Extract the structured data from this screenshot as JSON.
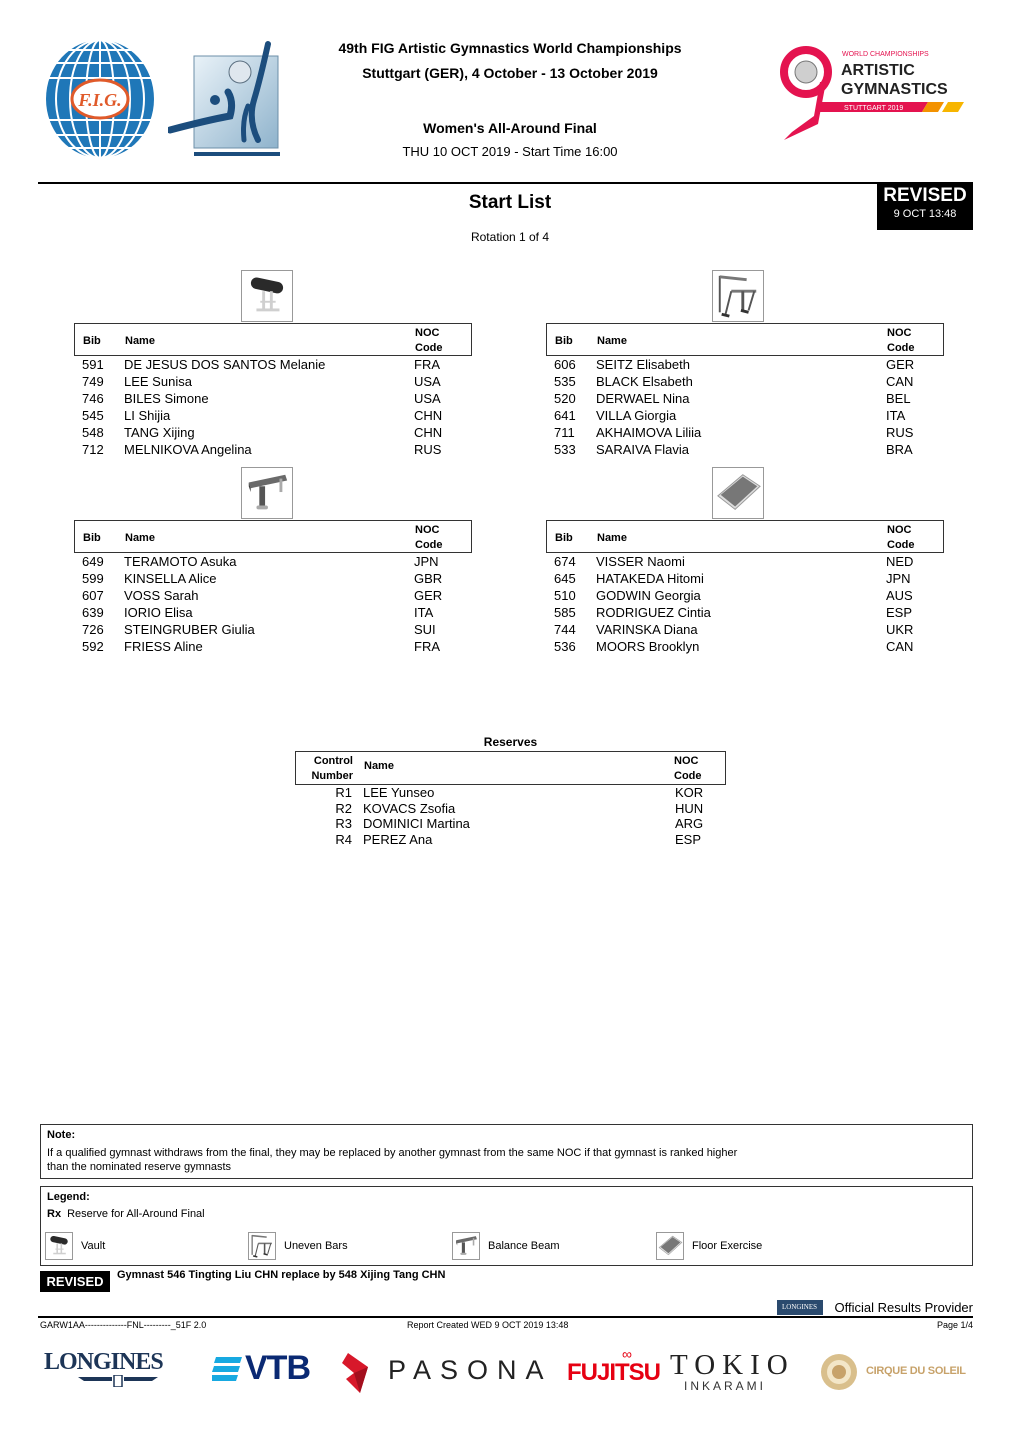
{
  "header": {
    "championship_title": "49th FIG Artistic Gymnastics World Championships",
    "location_dates": "Stuttgart (GER), 4 October - 13 October 2019",
    "event_name": "Women's All-Around Final",
    "session_info": "THU 10 OCT 2019 - Start Time 16:00",
    "logos": {
      "fig": "FIG globe logo",
      "fig_monogram": "F.I.G.",
      "event": "gymnasts emblem",
      "wc_line1": "WORLD CHAMPIONSHIPS",
      "wc_line2": "ARTISTIC",
      "wc_line3": "GYMNASTICS",
      "wc_line4": "STUTTGART 2019"
    }
  },
  "document": {
    "title": "Start List",
    "rotation": "Rotation 1 of 4",
    "revised_badge": {
      "label": "REVISED",
      "timestamp": "9 OCT 13:48"
    }
  },
  "table_headers": {
    "bib": "Bib",
    "name": "Name",
    "noc_line1": "NOC",
    "noc_line2": "Code"
  },
  "apparatus_groups": [
    {
      "apparatus": "Vault",
      "icon": "vault-icon",
      "rows": [
        {
          "bib": "591",
          "name": "DE JESUS DOS SANTOS Melanie",
          "noc": "FRA"
        },
        {
          "bib": "749",
          "name": "LEE Sunisa",
          "noc": "USA"
        },
        {
          "bib": "746",
          "name": "BILES Simone",
          "noc": "USA"
        },
        {
          "bib": "545",
          "name": "LI Shijia",
          "noc": "CHN"
        },
        {
          "bib": "548",
          "name": "TANG Xijing",
          "noc": "CHN"
        },
        {
          "bib": "712",
          "name": "MELNIKOVA Angelina",
          "noc": "RUS"
        }
      ]
    },
    {
      "apparatus": "Uneven Bars",
      "icon": "uneven-bars-icon",
      "rows": [
        {
          "bib": "606",
          "name": "SEITZ Elisabeth",
          "noc": "GER"
        },
        {
          "bib": "535",
          "name": "BLACK Elsabeth",
          "noc": "CAN"
        },
        {
          "bib": "520",
          "name": "DERWAEL Nina",
          "noc": "BEL"
        },
        {
          "bib": "641",
          "name": "VILLA Giorgia",
          "noc": "ITA"
        },
        {
          "bib": "711",
          "name": "AKHAIMOVA Liliia",
          "noc": "RUS"
        },
        {
          "bib": "533",
          "name": "SARAIVA Flavia",
          "noc": "BRA"
        }
      ]
    },
    {
      "apparatus": "Balance Beam",
      "icon": "balance-beam-icon",
      "rows": [
        {
          "bib": "649",
          "name": "TERAMOTO Asuka",
          "noc": "JPN"
        },
        {
          "bib": "599",
          "name": "KINSELLA Alice",
          "noc": "GBR"
        },
        {
          "bib": "607",
          "name": "VOSS Sarah",
          "noc": "GER"
        },
        {
          "bib": "639",
          "name": "IORIO Elisa",
          "noc": "ITA"
        },
        {
          "bib": "726",
          "name": "STEINGRUBER Giulia",
          "noc": "SUI"
        },
        {
          "bib": "592",
          "name": "FRIESS Aline",
          "noc": "FRA"
        }
      ]
    },
    {
      "apparatus": "Floor Exercise",
      "icon": "floor-exercise-icon",
      "rows": [
        {
          "bib": "674",
          "name": "VISSER Naomi",
          "noc": "NED"
        },
        {
          "bib": "645",
          "name": "HATAKEDA Hitomi",
          "noc": "JPN"
        },
        {
          "bib": "510",
          "name": "GODWIN Georgia",
          "noc": "AUS"
        },
        {
          "bib": "585",
          "name": "RODRIGUEZ Cintia",
          "noc": "ESP"
        },
        {
          "bib": "744",
          "name": "VARINSKA Diana",
          "noc": "UKR"
        },
        {
          "bib": "536",
          "name": "MOORS Brooklyn",
          "noc": "CAN"
        }
      ]
    }
  ],
  "reserves": {
    "title": "Reserves",
    "headers": {
      "control_line1": "Control",
      "control_line2": "Number",
      "name": "Name",
      "noc_line1": "NOC",
      "noc_line2": "Code"
    },
    "rows": [
      {
        "control": "R1",
        "name": "LEE Yunseo",
        "noc": "KOR"
      },
      {
        "control": "R2",
        "name": "KOVACS Zsofia",
        "noc": "HUN"
      },
      {
        "control": "R3",
        "name": "DOMINICI Martina",
        "noc": "ARG"
      },
      {
        "control": "R4",
        "name": "PEREZ Ana",
        "noc": "ESP"
      }
    ]
  },
  "note": {
    "label": "Note:",
    "line1": "If a qualified gymnast withdraws from the final, they may be replaced by another gymnast from the same NOC if that gymnast is ranked higher",
    "line2": "than the nominated reserve gymnasts"
  },
  "legend": {
    "label": "Legend:",
    "rx_code": "Rx",
    "rx_text": "Reserve for All-Around Final",
    "items": [
      {
        "label": "Vault",
        "icon": "vault-icon"
      },
      {
        "label": "Uneven Bars",
        "icon": "uneven-bars-icon"
      },
      {
        "label": "Balance Beam",
        "icon": "balance-beam-icon"
      },
      {
        "label": "Floor Exercise",
        "icon": "floor-exercise-icon"
      }
    ]
  },
  "revision": {
    "tag": "REVISED",
    "text": "Gymnast 546 Tingting Liu CHN replace by 548 Xijing Tang CHN"
  },
  "footer": {
    "provider_badge": "LONGINES",
    "provider_text": "Official Results Provider",
    "doc_code": "GARW1AA--------------FNL---------_51F 2.0",
    "report_created": "Report Created  WED 9 OCT 2019 13:48",
    "page": "Page 1/4"
  },
  "sponsors": {
    "longines": "LONGINES",
    "vtb": "VTB",
    "pasona": "PASONA",
    "fujitsu": "FUJITSU",
    "fujitsu_mark": "∞",
    "tokio": "TOKIO",
    "inkarami": "INKARAMI",
    "cirque": "CIRQUE DU SOLEIL"
  },
  "colors": {
    "fig_blue": "#1f77b8",
    "fig_orange": "#e05a2a",
    "wc_pink": "#e4134f",
    "wc_orange": "#f39200",
    "longines_navy": "#1d3557",
    "vtb_blue": "#0a2973",
    "vtb_light": "#17a9e1",
    "fujitsu_red": "#e60012",
    "cirque_gold": "#c7a26a"
  }
}
